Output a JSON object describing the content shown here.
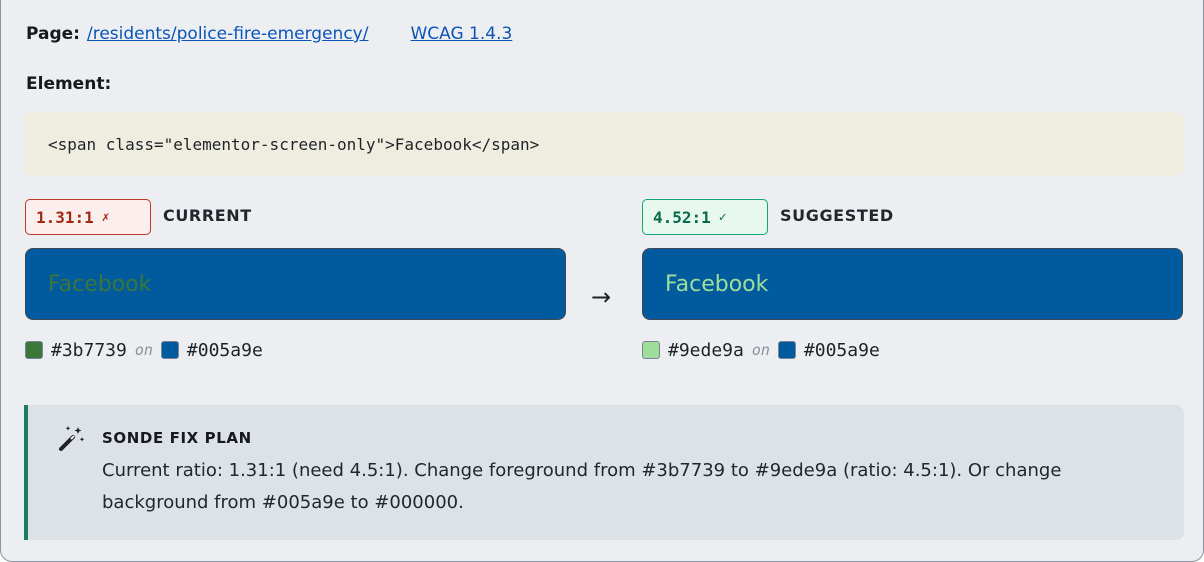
{
  "page": {
    "label": "Page:",
    "url_text": "/residents/police-fire-emergency/",
    "wcag_text": "WCAG 1.4.3"
  },
  "element": {
    "label": "Element:",
    "code": "<span class=\"elementor-screen-only\">Facebook</span>"
  },
  "current": {
    "ratio": "1.31:1",
    "mark": "✗",
    "label": "CURRENT",
    "sample_text": "Facebook",
    "foreground": "#3b7739",
    "background": "#005a9e",
    "on_word": "on"
  },
  "arrow": "→",
  "suggested": {
    "ratio": "4.52:1",
    "mark": "✓",
    "label": "SUGGESTED",
    "sample_text": "Facebook",
    "foreground": "#9ede9a",
    "background": "#005a9e",
    "on_word": "on"
  },
  "fix_plan": {
    "icon": "magic-wand-icon",
    "title": "SONDE FIX PLAN",
    "text": "Current ratio: 1.31:1 (need 4.5:1). Change foreground from #3b7739 to #9ede9a (ratio: 4.5:1). Or change background from #005a9e to #000000."
  },
  "colors": {
    "fail_accent": "#c0392b",
    "pass_accent": "#16a37a",
    "link": "#0b55b8",
    "fix_plan_accent": "#1e7a66"
  }
}
